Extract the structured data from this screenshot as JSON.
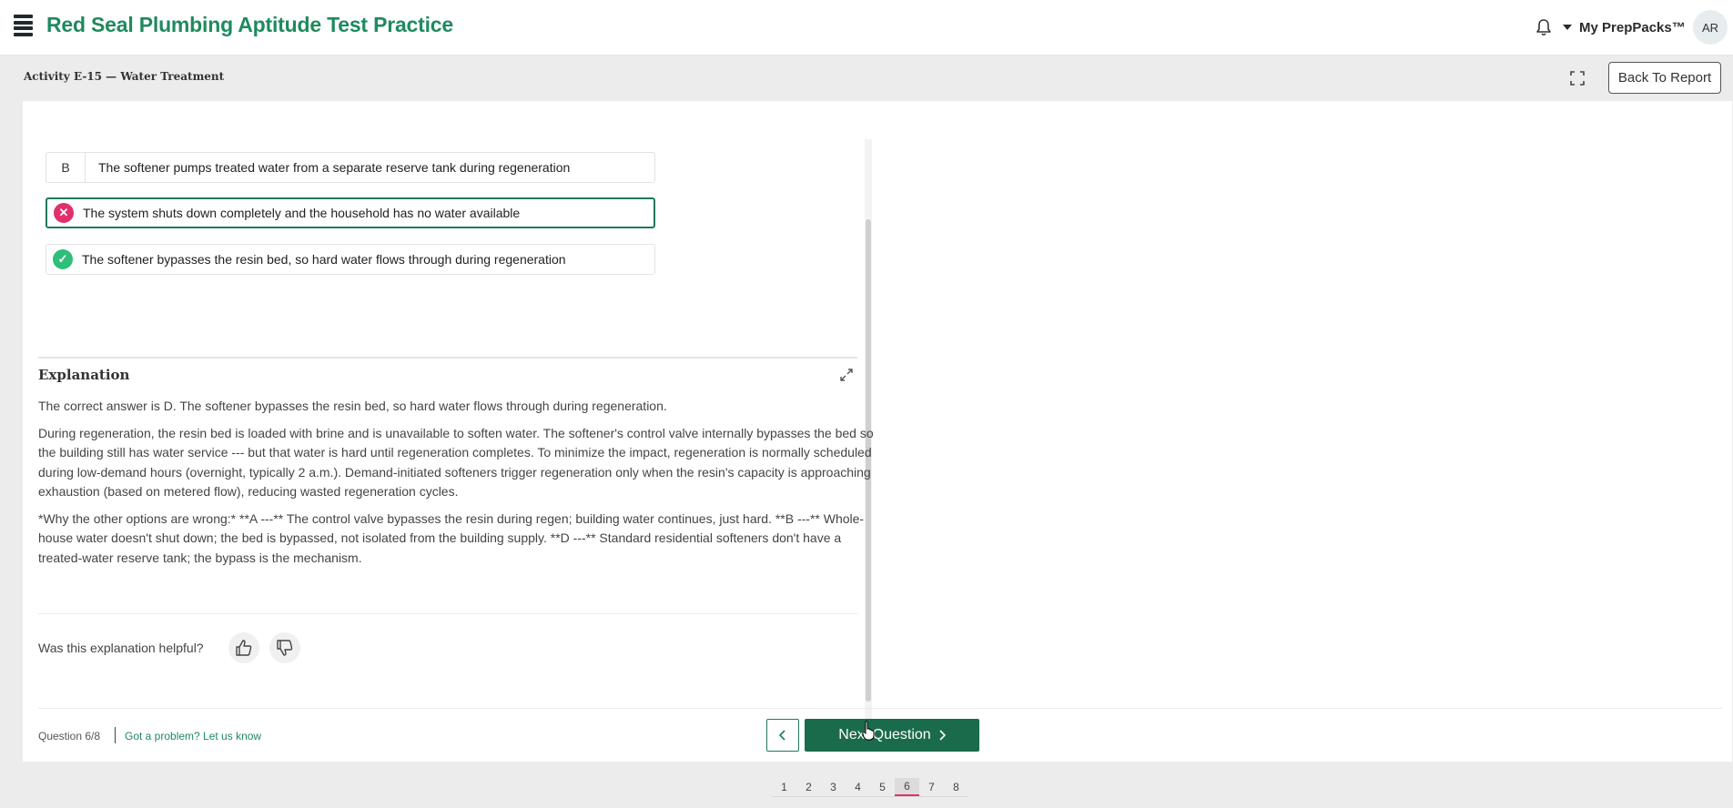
{
  "header": {
    "title": "Red Seal Plumbing Aptitude Test Practice",
    "menu_label": "My PrepPacks™",
    "avatar_initials": "AR"
  },
  "subheader": {
    "activity_title": "Activity E-15 — Water Treatment",
    "back_label": "Back To Report"
  },
  "options": [
    {
      "letter": "B",
      "text": "The softener pumps treated water from a separate reserve tank during regeneration",
      "state": "neutral"
    },
    {
      "letter": "",
      "text": "The system shuts down completely and the household has no water available",
      "state": "wrong"
    },
    {
      "letter": "",
      "text": "The softener bypasses the resin bed, so hard water flows through during regeneration",
      "state": "correct"
    }
  ],
  "explanation": {
    "title": "Explanation",
    "paragraphs": [
      "The correct answer is D. The softener bypasses the resin bed, so hard water flows through during regeneration.",
      "During regeneration, the resin bed is loaded with brine and is unavailable to soften water. The softener's control valve internally bypasses the bed so the building still has water service --- but that water is hard until regeneration completes. To minimize the impact, regeneration is normally scheduled during low-demand hours (overnight, typically 2 a.m.). Demand-initiated softeners trigger regeneration only when the resin's capacity is approaching exhaustion (based on metered flow), reducing wasted regeneration cycles.",
      "*Why the other options are wrong:* **A ---** The control valve bypasses the resin during regen; building water continues, just hard. **B ---** Whole-house water doesn't shut down; the bed is bypassed, not isolated from the building supply. **D ---** Standard residential softeners don't have a treated-water reserve tank; the bypass is the mechanism."
    ],
    "helpful_label": "Was this explanation helpful?"
  },
  "footer": {
    "question_count": "Question 6/8",
    "problem_link": "Got a problem? Let us know",
    "next_label": "Next Question"
  },
  "pagination": {
    "pages": [
      "1",
      "2",
      "3",
      "4",
      "5",
      "6",
      "7",
      "8"
    ],
    "active": "6"
  },
  "colors": {
    "brand": "#1f8a5e",
    "primary_button": "#1a6b4c",
    "wrong": "#e0306a",
    "correct": "#2fbf7a"
  },
  "icons": [
    "menu-icon",
    "bell-icon",
    "caret-down-icon",
    "fullscreen-icon",
    "close-icon",
    "check-icon",
    "expand-icon",
    "thumbs-up-icon",
    "thumbs-down-icon",
    "chevron-left-icon",
    "chevron-right-icon"
  ]
}
